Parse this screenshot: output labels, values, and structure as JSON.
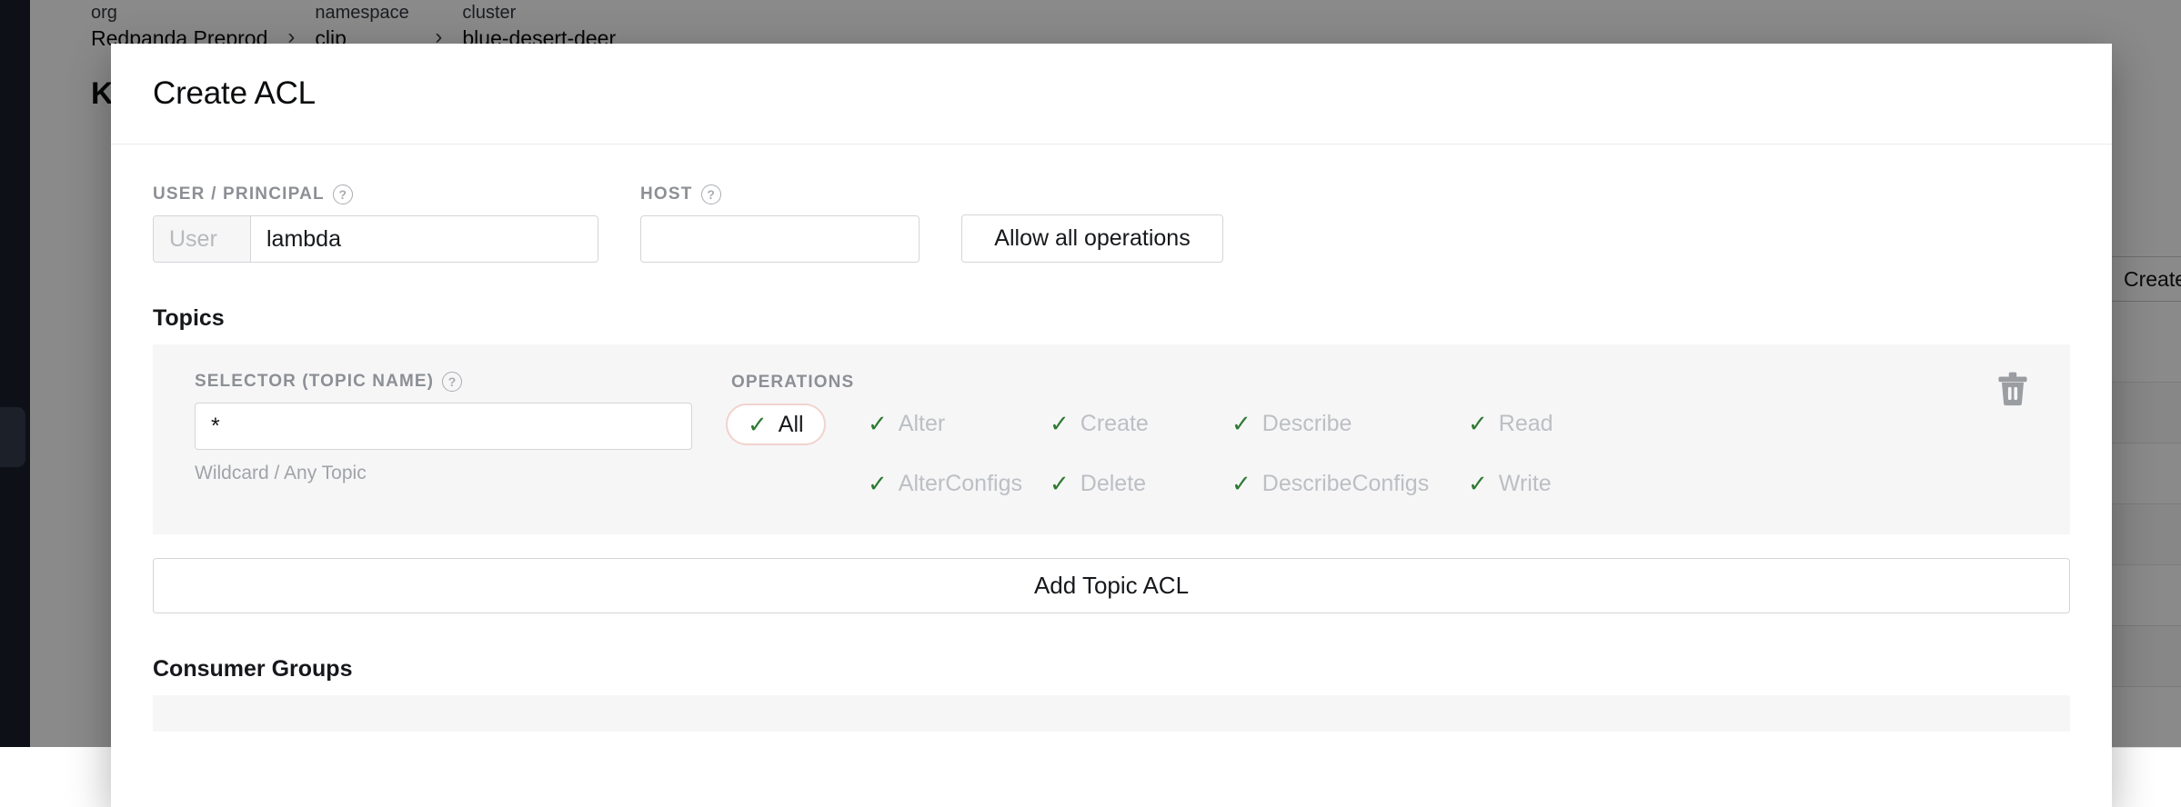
{
  "background": {
    "breadcrumb": [
      {
        "kind": "org",
        "value": "Redpanda Preprod"
      },
      {
        "kind": "namespace",
        "value": "clip"
      },
      {
        "kind": "cluster",
        "value": "blue-desert-deer"
      }
    ],
    "separator": "›",
    "page_title": "Kafka ACLs",
    "create_user_button": "Create User"
  },
  "modal": {
    "title": "Create ACL",
    "user_field": {
      "label": "USER / PRINCIPAL",
      "help": "?",
      "prefix": "User",
      "value": "lambda",
      "placeholder": ""
    },
    "host_field": {
      "label": "HOST",
      "help": "?",
      "value": "",
      "placeholder": ""
    },
    "allow_all_button": "Allow all operations",
    "topics": {
      "heading": "Topics",
      "selector": {
        "label": "SELECTOR (TOPIC NAME)",
        "help": "?",
        "value": "*",
        "hint": "Wildcard / Any Topic"
      },
      "operations": {
        "label": "OPERATIONS",
        "items": [
          {
            "name": "All",
            "selected": true,
            "row": 1,
            "col": 1
          },
          {
            "name": "Alter",
            "selected": false,
            "row": 1,
            "col": 2
          },
          {
            "name": "Create",
            "selected": false,
            "row": 1,
            "col": 3
          },
          {
            "name": "Describe",
            "selected": false,
            "row": 1,
            "col": 4
          },
          {
            "name": "Read",
            "selected": false,
            "row": 1,
            "col": 5
          },
          {
            "name": "AlterConfigs",
            "selected": false,
            "row": 2,
            "col": 2
          },
          {
            "name": "Delete",
            "selected": false,
            "row": 2,
            "col": 3
          },
          {
            "name": "DescribeConfigs",
            "selected": false,
            "row": 2,
            "col": 4
          },
          {
            "name": "Write",
            "selected": false,
            "row": 2,
            "col": 5
          }
        ],
        "check_glyph": "✓"
      },
      "delete_icon": "trash-icon",
      "add_button": "Add Topic ACL"
    },
    "consumer_groups": {
      "heading": "Consumer Groups"
    }
  },
  "colors": {
    "accent_pill_border": "#f2d3cd",
    "check_green": "#2f7a32",
    "muted_text": "#bcbfc3",
    "label_gray": "#8c8f94",
    "panel_bg": "#f6f6f7"
  }
}
